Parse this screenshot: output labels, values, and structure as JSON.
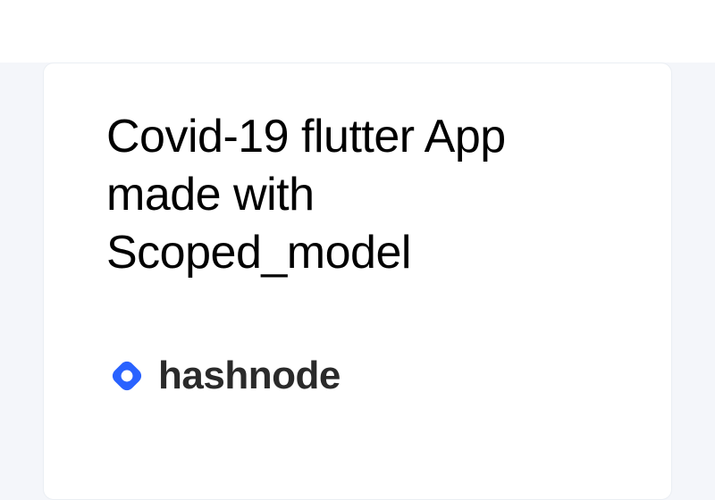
{
  "card": {
    "title": "Covid-19 flutter App made with Scoped_model"
  },
  "brand": {
    "name": "hashnode",
    "icon_name": "hashnode-icon",
    "accent_color": "#2962ff"
  }
}
